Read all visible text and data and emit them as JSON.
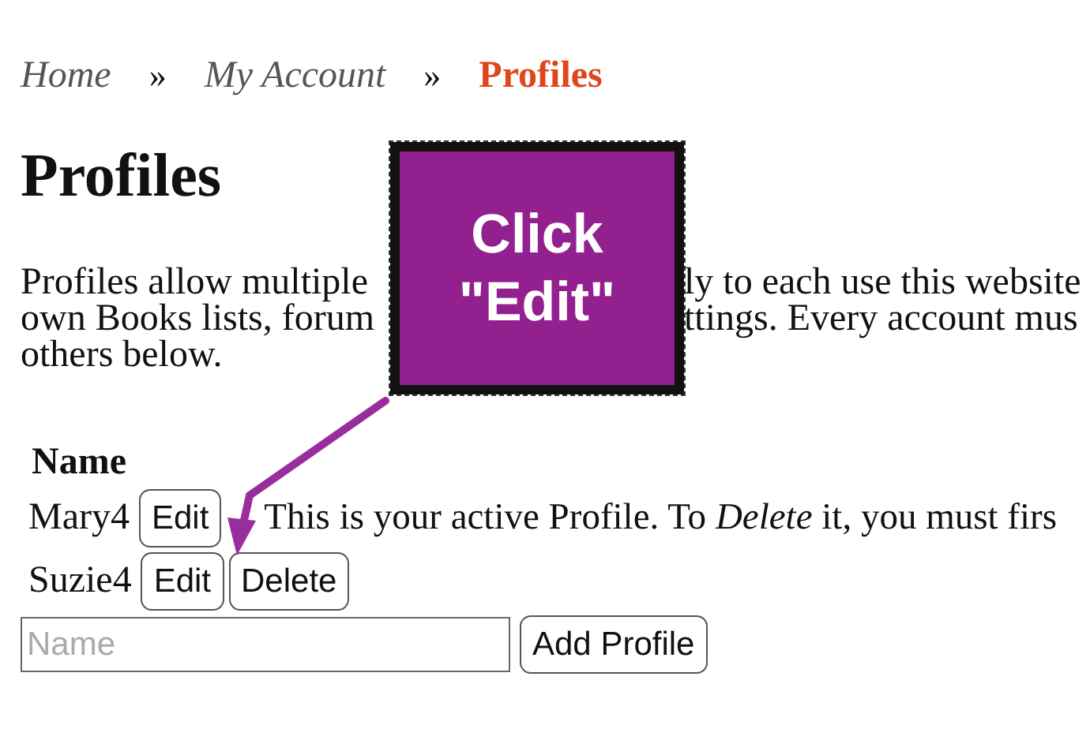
{
  "breadcrumb": [
    {
      "label": "Home",
      "current": false,
      "separator": "»"
    },
    {
      "label": "My Account",
      "current": false,
      "separator": "»"
    },
    {
      "label": "Profiles",
      "current": true
    }
  ],
  "heading": "Profiles",
  "intro_lines": [
    {
      "left": "Profiles allow multiple",
      "right": "ly to each use this website"
    },
    {
      "left": "own Books lists, forum",
      "right": "ttings. Every account mus"
    },
    {
      "left": "others below."
    }
  ],
  "annotation": {
    "text": "Click \"Edit\""
  },
  "table": {
    "header": "Name",
    "rows": [
      {
        "name": "Mary4",
        "buttons": [
          "Edit"
        ],
        "note": "This is your active Profile. To *Delete* it, you must firs"
      },
      {
        "name": "Suzie4",
        "buttons": [
          "Edit",
          "Delete"
        ]
      }
    ]
  },
  "add_form": {
    "placeholder": "Name",
    "button": "Add Profile"
  }
}
